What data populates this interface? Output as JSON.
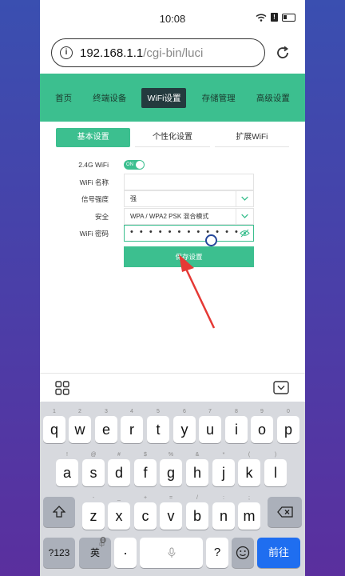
{
  "status_bar": {
    "time": "10:08"
  },
  "browser": {
    "url_host": "192.168.1.1",
    "url_path": "/cgi-bin/luci"
  },
  "nav": {
    "items": [
      {
        "label": "首页",
        "active": false
      },
      {
        "label": "终端设备",
        "active": false
      },
      {
        "label": "WiFi设置",
        "active": true
      },
      {
        "label": "存储管理",
        "active": false
      },
      {
        "label": "高级设置",
        "active": false
      }
    ]
  },
  "tabs": [
    {
      "label": "基本设置",
      "active": true
    },
    {
      "label": "个性化设置",
      "active": false
    },
    {
      "label": "扩展WiFi",
      "active": false
    }
  ],
  "form": {
    "wifi_24g": {
      "label": "2.4G WiFi",
      "toggle_text": "ON"
    },
    "wifi_name": {
      "label": "WiFi 名称",
      "value": ""
    },
    "signal": {
      "label": "信号强度",
      "value": "强"
    },
    "security": {
      "label": "安全",
      "value": "WPA / WPA2 PSK 混合模式"
    },
    "password": {
      "label": "WiFi 密码",
      "value": "• • • • • • • • • • • •"
    },
    "save_label": "保存设置"
  },
  "keyboard": {
    "row1": [
      {
        "k": "q",
        "s": "1"
      },
      {
        "k": "w",
        "s": "2"
      },
      {
        "k": "e",
        "s": "3"
      },
      {
        "k": "r",
        "s": "4"
      },
      {
        "k": "t",
        "s": "5"
      },
      {
        "k": "y",
        "s": "6"
      },
      {
        "k": "u",
        "s": "7"
      },
      {
        "k": "i",
        "s": "8"
      },
      {
        "k": "o",
        "s": "9"
      },
      {
        "k": "p",
        "s": "0"
      }
    ],
    "row2": [
      {
        "k": "a",
        "s": "!"
      },
      {
        "k": "s",
        "s": "@"
      },
      {
        "k": "d",
        "s": "#"
      },
      {
        "k": "f",
        "s": "$"
      },
      {
        "k": "g",
        "s": "%"
      },
      {
        "k": "h",
        "s": "&"
      },
      {
        "k": "j",
        "s": "*"
      },
      {
        "k": "k",
        "s": "("
      },
      {
        "k": "l",
        "s": ")"
      }
    ],
    "row3": [
      {
        "k": "z",
        "s": "-"
      },
      {
        "k": "x",
        "s": "_"
      },
      {
        "k": "c",
        "s": "+"
      },
      {
        "k": "v",
        "s": "="
      },
      {
        "k": "b",
        "s": "/"
      },
      {
        "k": "n",
        "s": ":"
      },
      {
        "k": "m",
        "s": ";"
      }
    ],
    "num_label": "?123",
    "lang_label": "英",
    "lang_sub": "中",
    "dot_label": "·",
    "question_label": "?",
    "enter_label": "前往"
  }
}
